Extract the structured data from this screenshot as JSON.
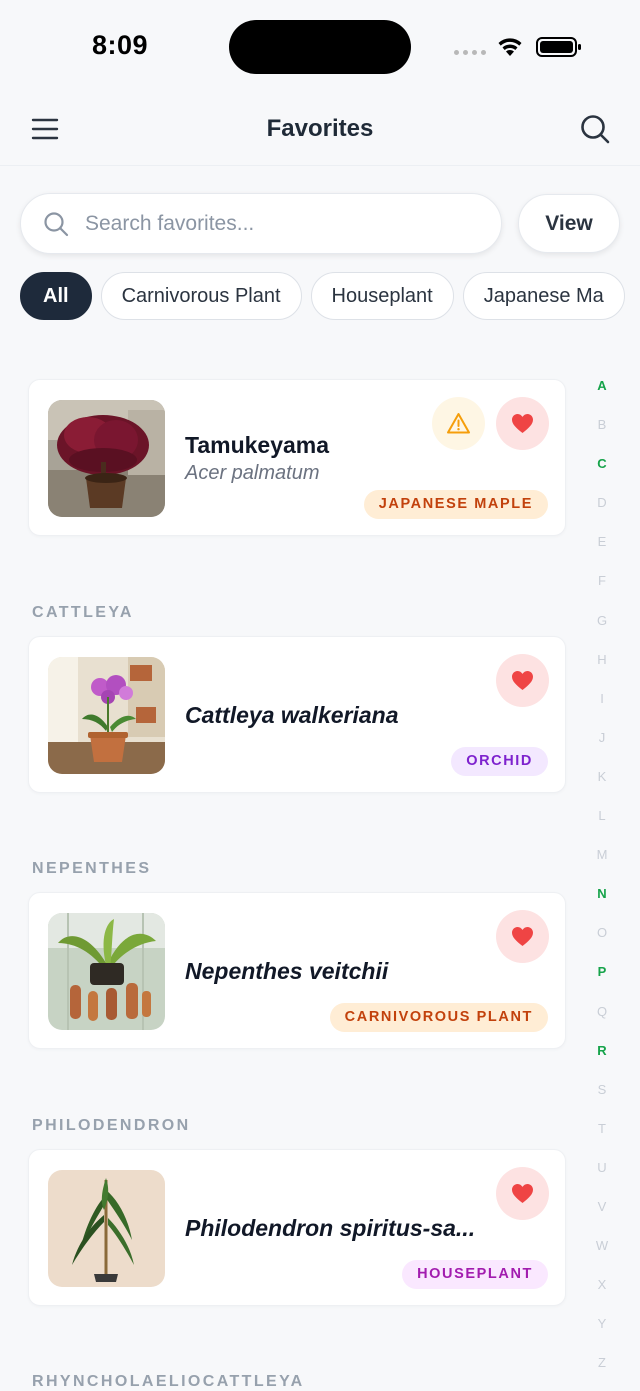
{
  "status_bar": {
    "time": "8:09"
  },
  "header": {
    "title": "Favorites"
  },
  "search": {
    "placeholder": "Search favorites...",
    "value": ""
  },
  "view_button": {
    "label": "View"
  },
  "filter_chips": [
    {
      "label": "All",
      "selected": true
    },
    {
      "label": "Carnivorous Plant",
      "selected": false
    },
    {
      "label": "Houseplant",
      "selected": false
    },
    {
      "label": "Japanese Ma",
      "selected": false
    }
  ],
  "alphabet_index": {
    "letters": [
      "A",
      "B",
      "C",
      "D",
      "E",
      "F",
      "G",
      "H",
      "I",
      "J",
      "K",
      "L",
      "M",
      "N",
      "O",
      "P",
      "Q",
      "R",
      "S",
      "T",
      "U",
      "V",
      "W",
      "X",
      "Y",
      "Z"
    ],
    "active": [
      "A",
      "C",
      "N",
      "P",
      "R"
    ],
    "active_color": "#16a34a"
  },
  "sections": [
    {
      "header": "",
      "items": [
        {
          "name": "Tamukeyama",
          "scientific": "Acer palmatum",
          "tag": "JAPANESE MAPLE",
          "tag_color": "orange",
          "warning": true,
          "favorite": true
        }
      ]
    },
    {
      "header": "CATTLEYA",
      "items": [
        {
          "name": "Cattleya walkeriana",
          "tag": "ORCHID",
          "tag_color": "purple",
          "warning": false,
          "favorite": true
        }
      ]
    },
    {
      "header": "NEPENTHES",
      "items": [
        {
          "name": "Nepenthes veitchii",
          "tag": "CARNIVOROUS PLANT",
          "tag_color": "orange",
          "warning": false,
          "favorite": true
        }
      ]
    },
    {
      "header": "PHILODENDRON",
      "items": [
        {
          "name": "Philodendron spiritus-sa...",
          "tag": "HOUSEPLANT",
          "tag_color": "pink",
          "warning": false,
          "favorite": true
        }
      ]
    },
    {
      "header": "RHYNCHOLAELIOCATTLEYA",
      "items": []
    }
  ],
  "colors": {
    "accent_dark": "#1e2a3b",
    "favorite_red": "#ef4444",
    "warning_amber": "#f59e0b"
  }
}
